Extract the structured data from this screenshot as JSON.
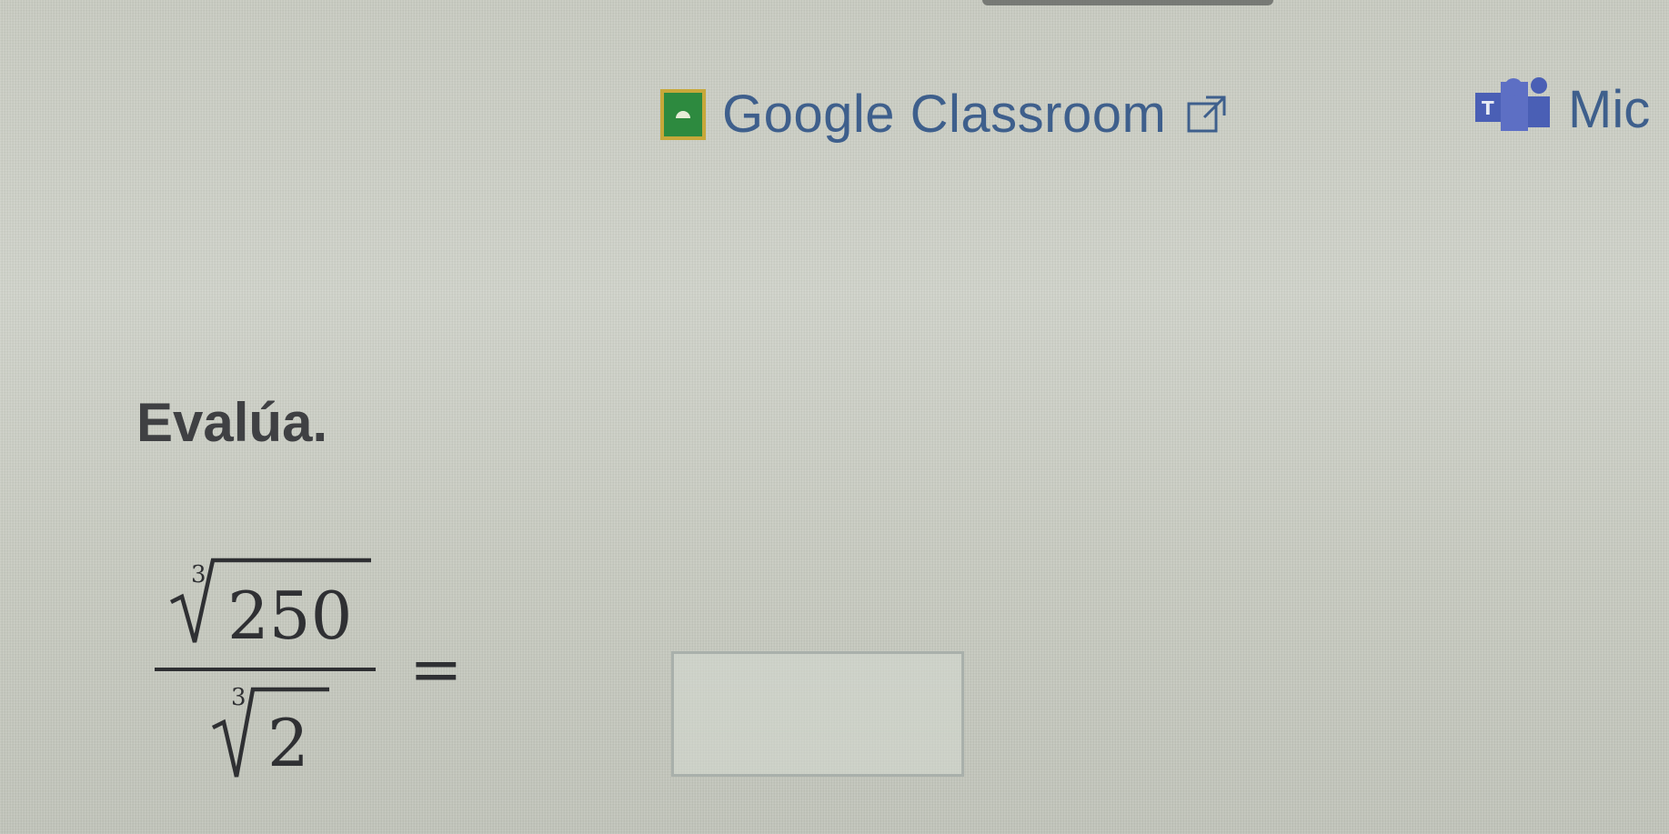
{
  "share": {
    "google_classroom_label": "Google Classroom",
    "microsoft_label": "Mic",
    "icons": [
      "google-classroom-icon",
      "external-link-icon",
      "microsoft-teams-icon"
    ]
  },
  "problem": {
    "prompt": "Evalúa.",
    "numerator": {
      "root_index": "3",
      "radicand": "250"
    },
    "denominator": {
      "root_index": "3",
      "radicand": "2"
    },
    "equals": "=",
    "answer_value": ""
  }
}
